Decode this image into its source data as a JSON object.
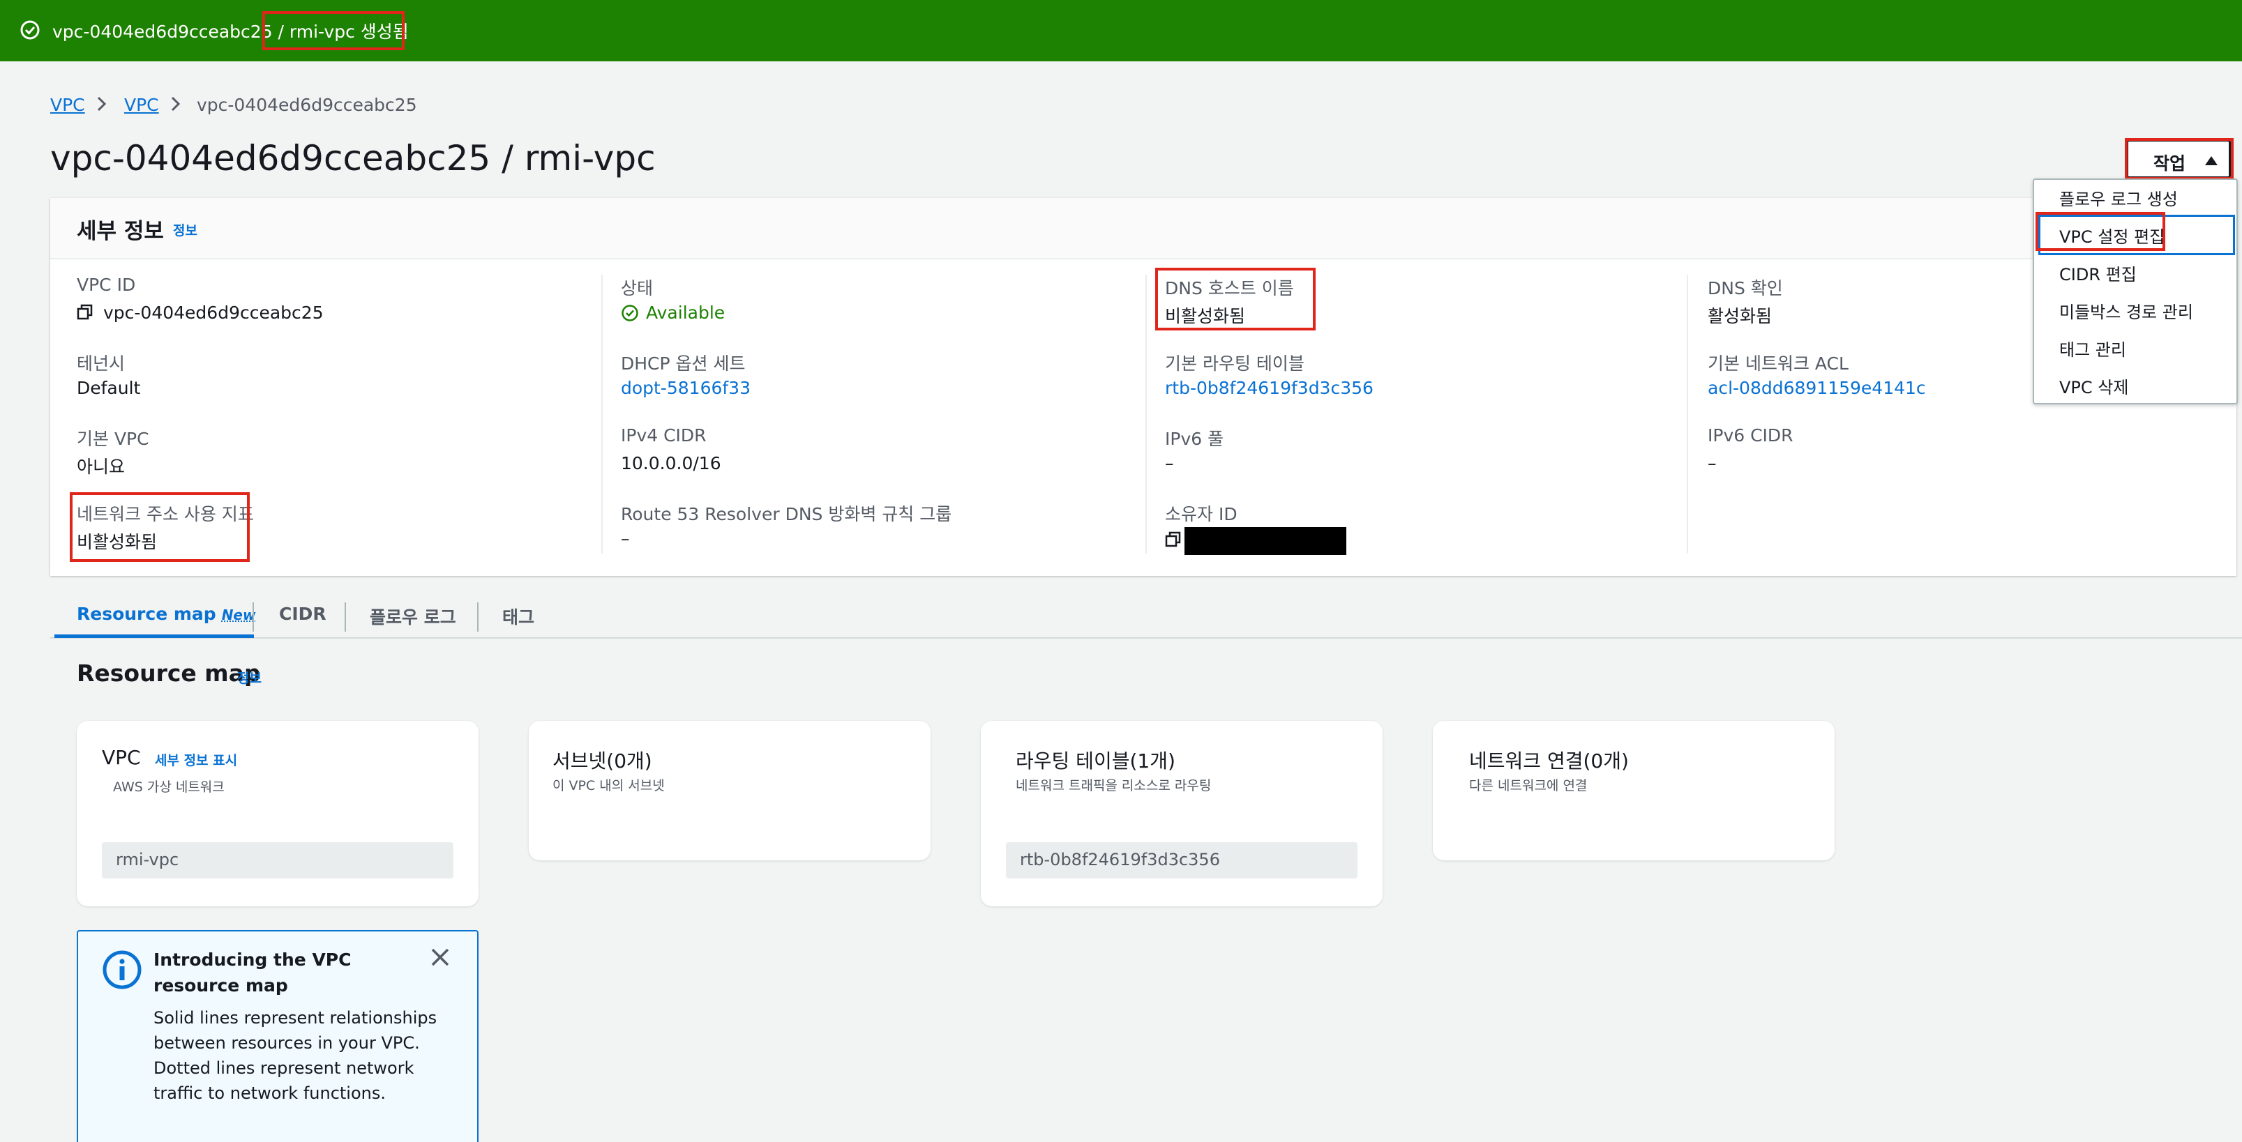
{
  "flash": {
    "message_prefix": "vpc-0404ed6d9cceabc25 / ",
    "message_created": "rmi-vpc 생성됨",
    "color": "#1d8102"
  },
  "breadcrumb": {
    "items": [
      "VPC",
      "VPC",
      "vpc-0404ed6d9cceabc25"
    ]
  },
  "page": {
    "title": "vpc-0404ed6d9cceabc25 / rmi-vpc",
    "actions_label": "작업"
  },
  "actions_menu": {
    "items": [
      "플로우 로그 생성",
      "VPC 설정 편집",
      "CIDR 편집",
      "미들박스 경로 관리",
      "태그 관리",
      "VPC 삭제"
    ]
  },
  "details": {
    "title": "세부 정보",
    "info_link": "정보",
    "fields": {
      "vpc_id": {
        "label": "VPC ID",
        "value": "vpc-0404ed6d9cceabc25"
      },
      "state": {
        "label": "상태",
        "value": "Available"
      },
      "dns_hostnames": {
        "label": "DNS 호스트 이름",
        "value": "비활성화됨"
      },
      "dns_resolution": {
        "label": "DNS 확인",
        "value": "활성화됨"
      },
      "tenancy": {
        "label": "테넌시",
        "value": "Default"
      },
      "dhcp": {
        "label": "DHCP 옵션 세트",
        "value": "dopt-58166f33"
      },
      "main_route_table": {
        "label": "기본 라우팅 테이블",
        "value": "rtb-0b8f24619f3d3c356"
      },
      "main_nacl": {
        "label": "기본 네트워크 ACL",
        "value": "acl-08dd6891159e4141c"
      },
      "default_vpc": {
        "label": "기본 VPC",
        "value": "아니요"
      },
      "ipv4_cidr": {
        "label": "IPv4 CIDR",
        "value": "10.0.0.0/16"
      },
      "ipv6_pool": {
        "label": "IPv6 풀",
        "value": "–"
      },
      "ipv6_cidr": {
        "label": "IPv6 CIDR",
        "value": "–"
      },
      "net_addr_usage": {
        "label": "네트워크 주소 사용 지표",
        "value": "비활성화됨"
      },
      "route53": {
        "label": "Route 53 Resolver DNS 방화벽 규칙 그룹",
        "value": "–"
      },
      "owner_id": {
        "label": "소유자 ID",
        "value": ""
      }
    }
  },
  "tabs": {
    "items": [
      "Resource map",
      "CIDR",
      "플로우 로그",
      "태그"
    ],
    "new_badge": "New"
  },
  "resource_map": {
    "title": "Resource map",
    "info_link": "정보",
    "cards": {
      "vpc": {
        "title": "VPC",
        "link": "세부 정보 표시",
        "subtitle": "AWS 가상 네트워크",
        "chip": "rmi-vpc"
      },
      "subnets": {
        "title": "서브넷(0개)",
        "subtitle": "이 VPC 내의 서브넷"
      },
      "route_tables": {
        "title": "라우팅 테이블(1개)",
        "subtitle": "네트워크 트래픽을 리소스로 라우팅",
        "chip": "rtb-0b8f24619f3d3c356"
      },
      "network_connections": {
        "title": "네트워크 연결(0개)",
        "subtitle": "다른 네트워크에 연결"
      }
    },
    "intro_box": {
      "title": "Introducing the VPC resource map",
      "body": "Solid lines represent relationships between resources in your VPC. Dotted lines represent network traffic to network functions."
    }
  }
}
